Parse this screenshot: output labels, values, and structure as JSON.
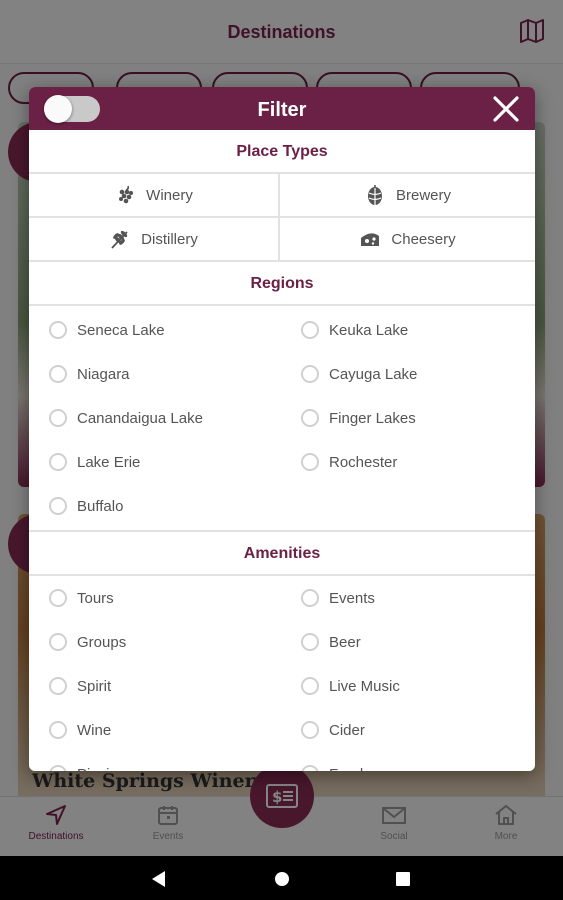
{
  "app": {
    "title": "Destinations",
    "card_name": "White Springs Winery"
  },
  "bottom_nav": [
    {
      "label": "Destinations",
      "icon": "navigation-arrow-icon"
    },
    {
      "label": "Events",
      "icon": "calendar-icon"
    },
    {
      "label": "Social",
      "icon": "mail-icon"
    },
    {
      "label": "More",
      "icon": "home-icon"
    }
  ],
  "filter": {
    "title": "Filter",
    "toggle_on": false,
    "place_types_heading": "Place Types",
    "place_types": [
      {
        "label": "Winery",
        "icon": "grapes-icon"
      },
      {
        "label": "Brewery",
        "icon": "hops-icon"
      },
      {
        "label": "Distillery",
        "icon": "wheat-icon"
      },
      {
        "label": "Cheesery",
        "icon": "cheese-icon"
      }
    ],
    "regions_heading": "Regions",
    "regions": [
      "Seneca Lake",
      "Keuka Lake",
      "Niagara",
      "Cayuga Lake",
      "Canandaigua Lake",
      "Finger Lakes",
      "Lake Erie",
      "Rochester",
      "Buffalo"
    ],
    "amenities_heading": "Amenities",
    "amenities": [
      "Tours",
      "Events",
      "Groups",
      "Beer",
      "Spirit",
      "Live Music",
      "Wine",
      "Cider",
      "Picnic",
      "Food"
    ]
  },
  "colors": {
    "brand": "#6b2146",
    "accent": "#8a2c55"
  }
}
